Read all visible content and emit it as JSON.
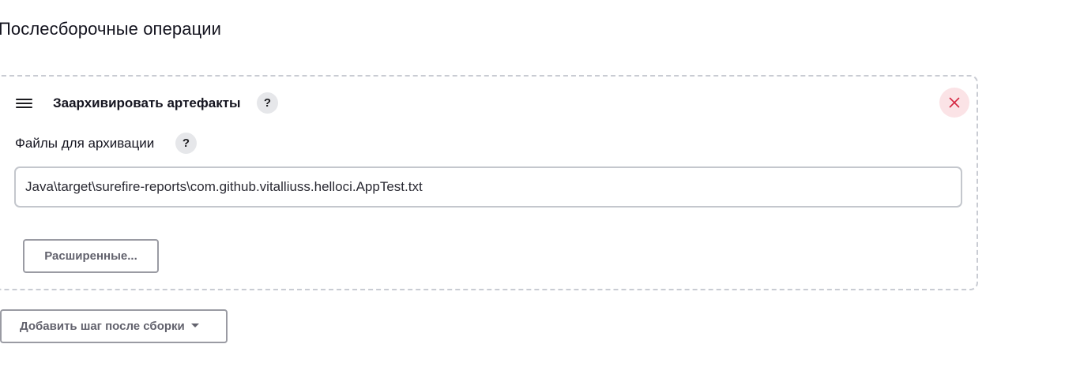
{
  "section": {
    "title": "Послесборочные операции"
  },
  "step": {
    "title": "Заархивировать артефакты",
    "help": "?",
    "field": {
      "label": "Файлы для архивации",
      "help": "?",
      "value": "Java\\target\\surefire-reports\\com.github.vitalliuss.helloci.AppTest.txt"
    },
    "advanced_label": "Расширенные..."
  },
  "add_step": {
    "label": "Добавить шаг после сборки"
  },
  "colors": {
    "close_bg": "#fbe3e6",
    "close_icon": "#d4243f",
    "button_text": "#62626d",
    "border": "#c9ccd3"
  },
  "icons": {
    "drag": "hamburger-icon",
    "close": "close-icon",
    "help": "question-icon",
    "dropdown": "caret-down-icon"
  }
}
